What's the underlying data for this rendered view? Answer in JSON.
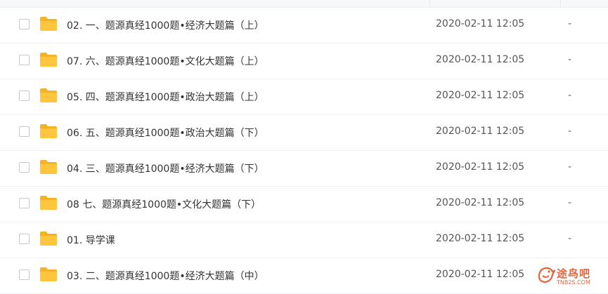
{
  "files": [
    {
      "name": "02. 一、题源真经1000题•经济大题篇（上）",
      "modified": "2020-02-11 12:05",
      "size": "-"
    },
    {
      "name": "07. 六、题源真经1000题•文化大题篇（上）",
      "modified": "2020-02-11 12:05",
      "size": "-"
    },
    {
      "name": "05. 四、题源真经1000题•政治大题篇（上）",
      "modified": "2020-02-11 12:05",
      "size": "-"
    },
    {
      "name": "06. 五、题源真经1000题•政治大题篇（下）",
      "modified": "2020-02-11 12:05",
      "size": "-"
    },
    {
      "name": "04. 三、题源真经1000题•经济大题篇（下）",
      "modified": "2020-02-11 12:05",
      "size": "-"
    },
    {
      "name": "08 七、题源真经1000题•文化大题篇（下）",
      "modified": "2020-02-11 12:05",
      "size": "-"
    },
    {
      "name": "01. 导学课",
      "modified": "2020-02-11 12:05",
      "size": "-"
    },
    {
      "name": "03. 二、题源真经1000题•经济大题篇（中）",
      "modified": "2020-02-11 12:05",
      "size": "-"
    }
  ],
  "watermark": {
    "text": "途鸟吧",
    "subtext": "TNB2S.COM"
  },
  "colors": {
    "folder": "#FFC53D",
    "folder_tab": "#F5B324",
    "watermark": "#E8643C"
  }
}
